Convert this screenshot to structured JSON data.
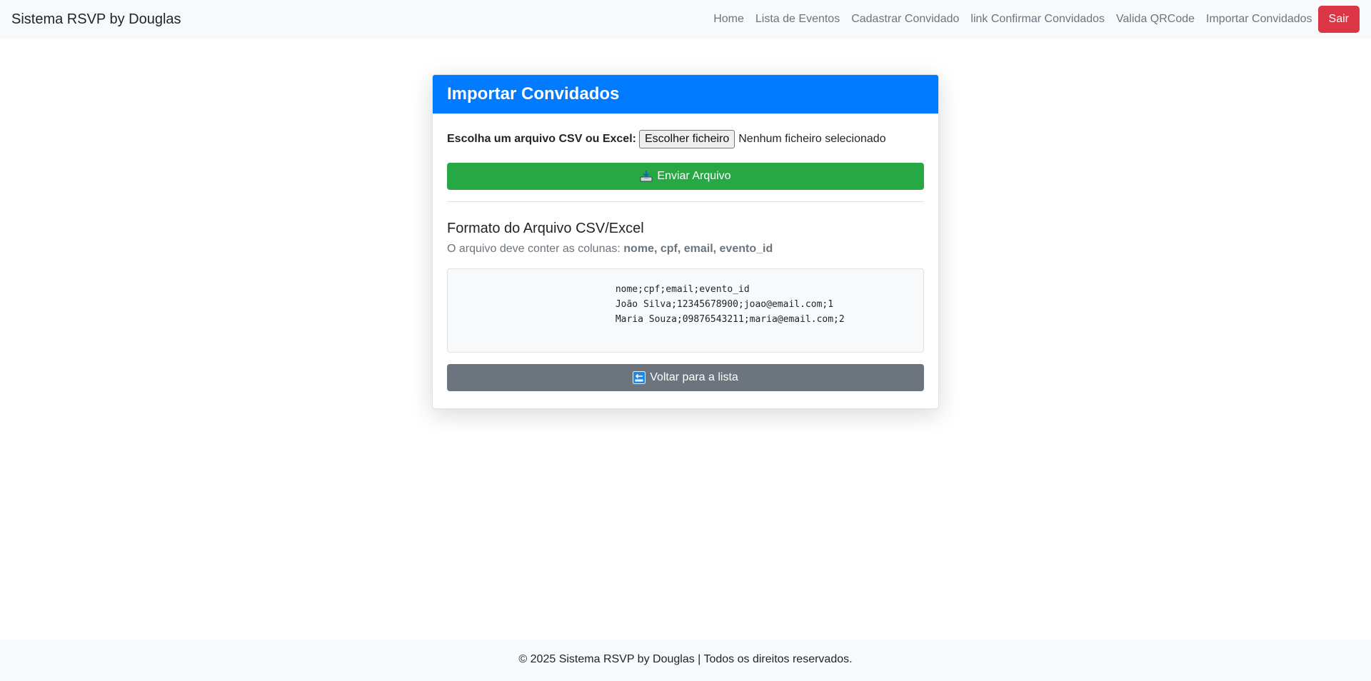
{
  "navbar": {
    "brand": "Sistema RSVP by Douglas",
    "links": [
      "Home",
      "Lista de Eventos",
      "Cadastrar Convidado",
      "link Confirmar Convidados",
      "Valida QRCode",
      "Importar Convidados"
    ],
    "logout_label": "Sair"
  },
  "card": {
    "title": "Importar Convidados",
    "file_label": "Escolha um arquivo CSV ou Excel:",
    "file_button": "Escolher ficheiro",
    "file_status": "Nenhum ficheiro selecionado",
    "submit_label": "Enviar Arquivo",
    "format_title": "Formato do Arquivo CSV/Excel",
    "format_hint_prefix": "O arquivo deve conter as colunas:",
    "format_hint_columns": "nome, cpf, email, evento_id",
    "sample_lines": [
      "nome;cpf;email;evento_id",
      "João Silva;12345678900;joao@email.com;1",
      "Maria Souza;09876543211;maria@email.com;2"
    ],
    "back_label": "Voltar para a lista"
  },
  "footer": {
    "text": "© 2025 Sistema RSVP by Douglas | Todos os direitos reservados."
  },
  "icons": {
    "submit": "inbox-tray-icon",
    "back": "back-arrow-icon"
  },
  "colors": {
    "primary": "#007bff",
    "success": "#28a745",
    "secondary": "#6c757d",
    "danger": "#dc3545"
  }
}
